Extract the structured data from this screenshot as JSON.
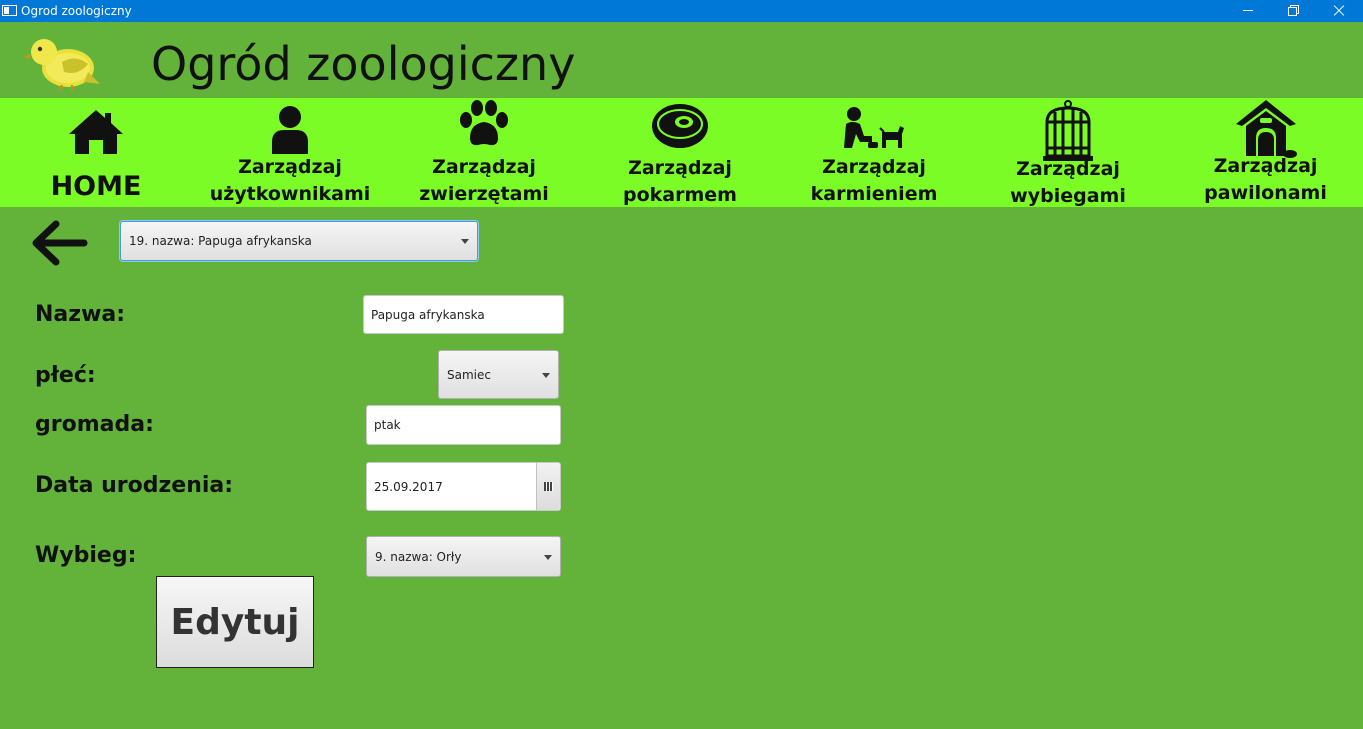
{
  "window": {
    "title": "Ogrod zoologiczny"
  },
  "header": {
    "title": "Ogród zoologiczny",
    "logo": "bird-icon"
  },
  "nav": {
    "items": [
      {
        "label": "HOME",
        "icon": "home-icon"
      },
      {
        "label": "Zarządzaj\nużytkownikami",
        "icon": "user-icon"
      },
      {
        "label": "Zarządzaj\nzwierzętami",
        "icon": "paw-icon"
      },
      {
        "label": "Zarządzaj\npokarmem",
        "icon": "meat-icon"
      },
      {
        "label": "Zarządzaj\nkarmieniem",
        "icon": "feeding-icon"
      },
      {
        "label": "Zarządzaj\nwybiegami",
        "icon": "cage-icon"
      },
      {
        "label": "Zarządzaj\npawilonami",
        "icon": "pavilion-icon"
      }
    ]
  },
  "animal_select": {
    "value": "19. nazwa: Papuga afrykanska"
  },
  "form": {
    "name": {
      "label": "Nazwa:",
      "value": "Papuga afrykanska"
    },
    "sex": {
      "label": "płeć:",
      "value": "Samiec"
    },
    "group": {
      "label": "gromada:",
      "value": "ptak"
    },
    "birth_date": {
      "label": "Data urodzenia:",
      "value": "25.09.2017"
    },
    "enclosure": {
      "label": "Wybieg:",
      "value": "9. nazwa: Orły"
    }
  },
  "edit_button": {
    "label": "Edytuj"
  },
  "colors": {
    "titlebar": "#0078d7",
    "background": "#63b33a",
    "nav_background": "#7cfc27"
  }
}
